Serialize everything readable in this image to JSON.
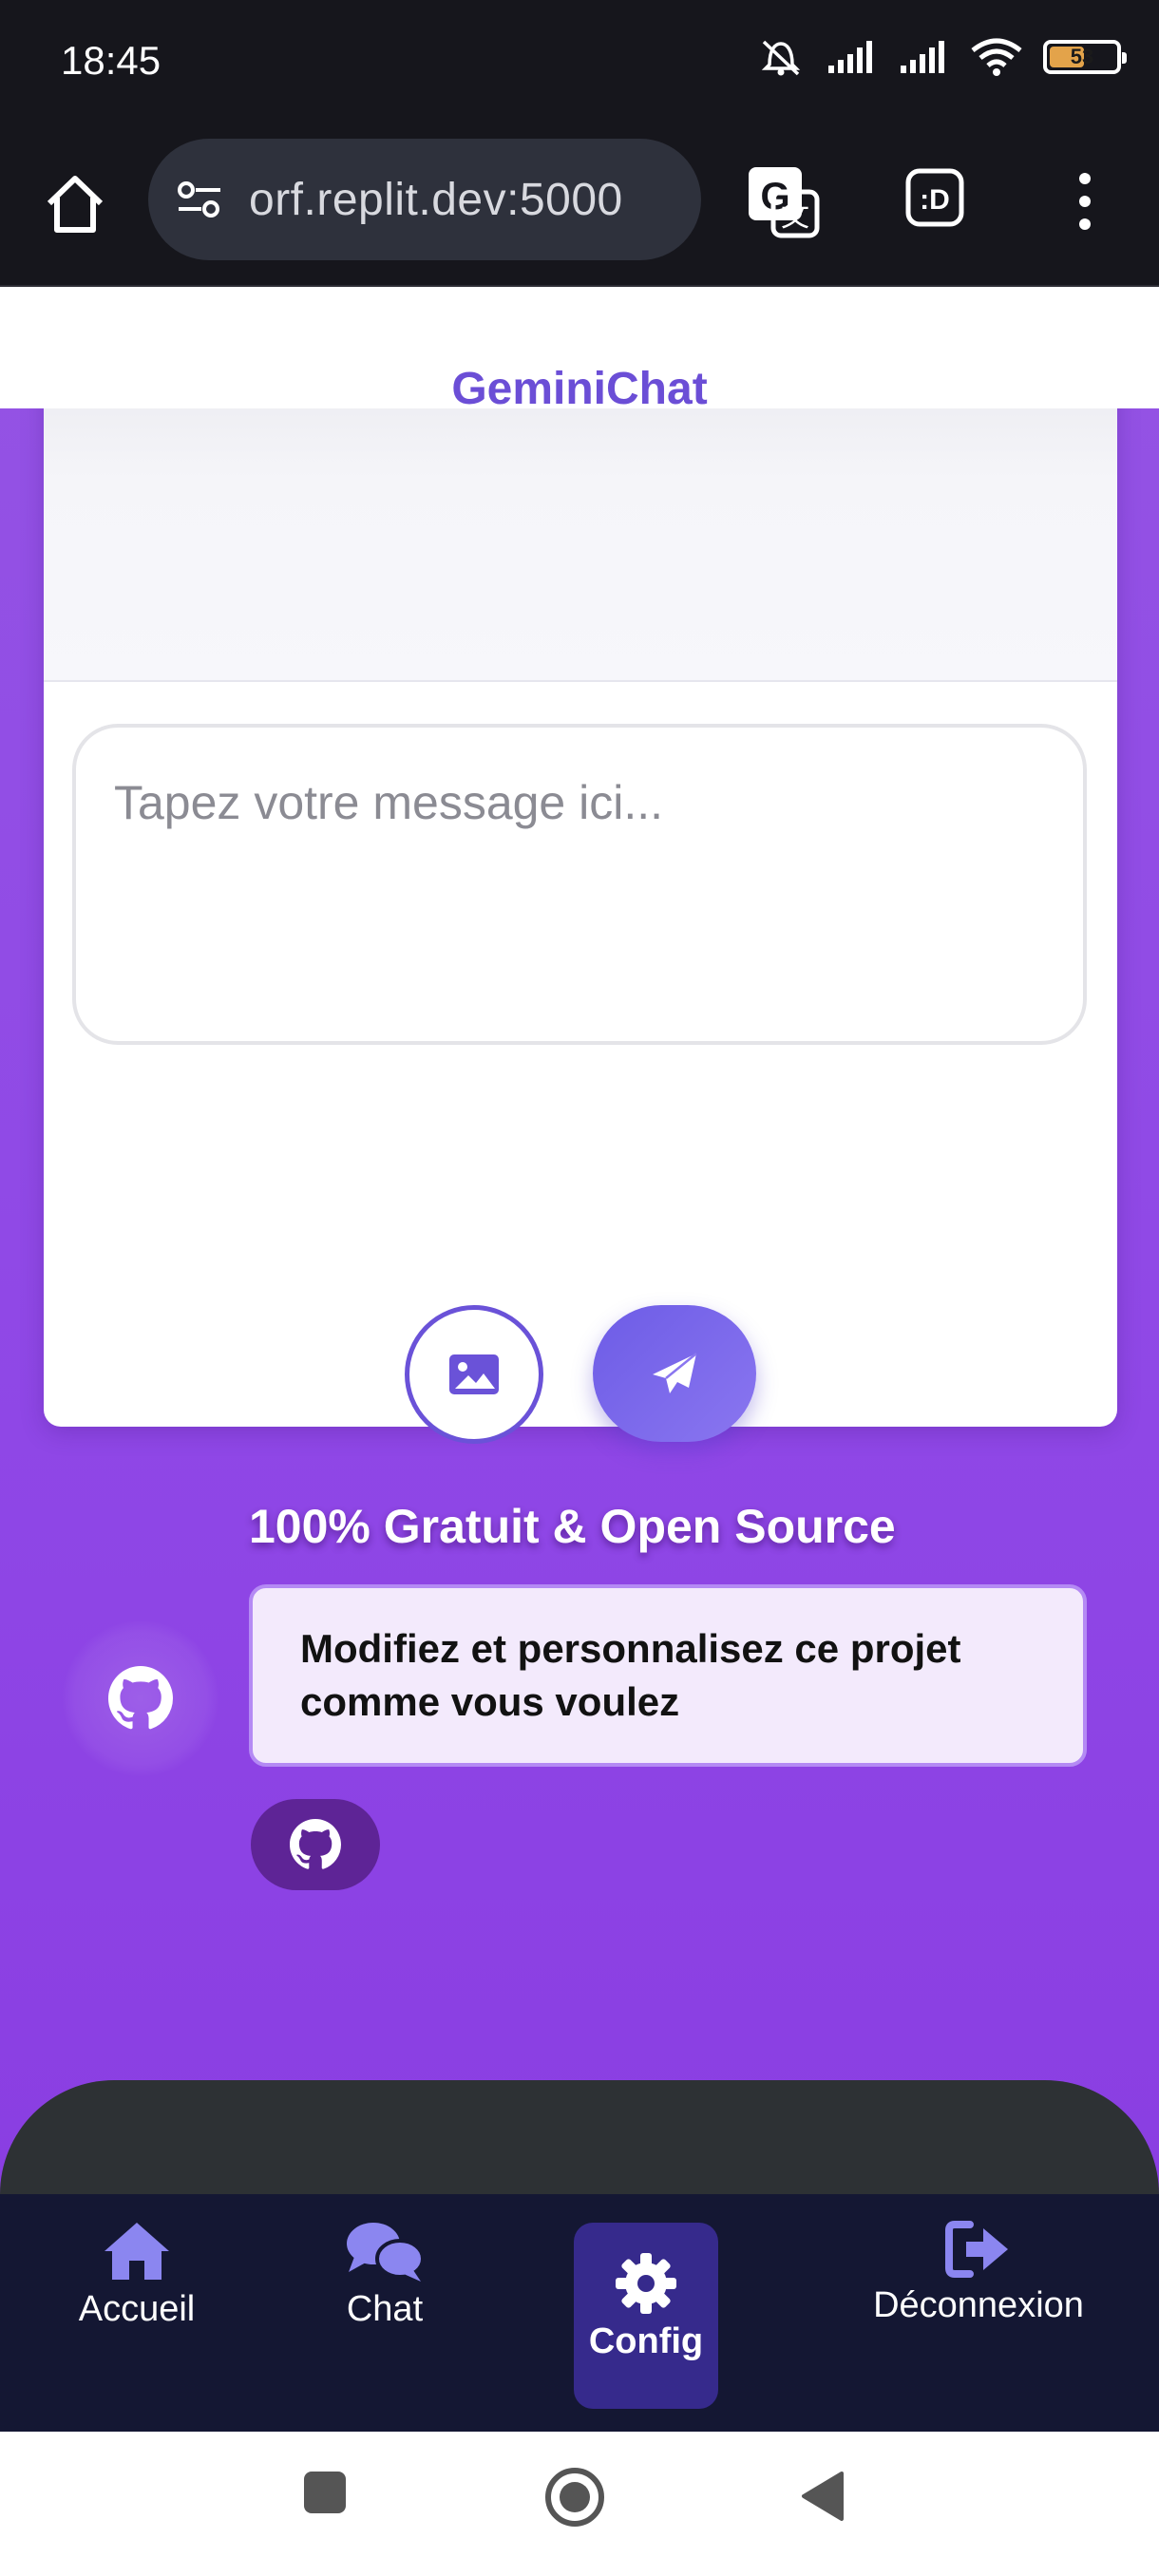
{
  "status_bar": {
    "time": "18:45",
    "battery": "53",
    "icons": [
      "mute-icon",
      "signal-icon",
      "signal-icon",
      "wifi-icon",
      "battery-icon"
    ]
  },
  "browser": {
    "url": "orf.replit.dev:5000",
    "icons": [
      "home-icon",
      "site-settings-icon",
      "translate-icon",
      "dark-mode-icon",
      "more-menu-icon"
    ]
  },
  "app": {
    "title": "GeminiChat",
    "input_placeholder": "Tapez votre message ici...",
    "image_button_icon": "image-icon",
    "send_button_icon": "paper-plane-icon"
  },
  "promo": {
    "title": "100% Gratuit & Open Source",
    "description": "Modifiez et personnalisez ce projet comme vous voulez",
    "icon": "github-icon"
  },
  "bottom_nav": {
    "items": [
      {
        "label": "Accueil",
        "icon": "home-icon"
      },
      {
        "label": "Chat",
        "icon": "chat-icon"
      },
      {
        "label": "Config",
        "icon": "gear-icon",
        "active": true
      },
      {
        "label": "Déconnexion",
        "icon": "logout-icon"
      }
    ]
  },
  "colors": {
    "brand": "#6b4ed6",
    "background_purple": "#9050e4",
    "nav_bg": "#141733",
    "nav_active": "#362a8c",
    "icon_accent": "#8b86f0"
  }
}
